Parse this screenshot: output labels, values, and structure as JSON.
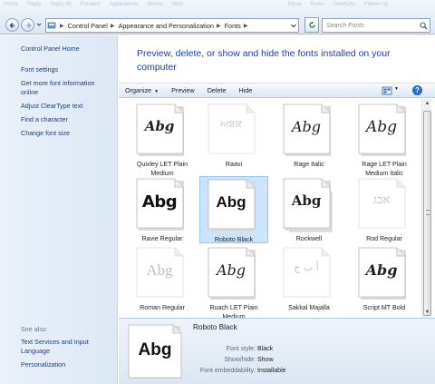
{
  "titlebar_menu_left": [
    "Home",
    "Reply",
    "Reply All",
    "Forward",
    "Applications",
    "Books",
    "Next"
  ],
  "titlebar_menu_right": [
    "Move",
    "Rules",
    "OneNote",
    "Follow Up"
  ],
  "address": {
    "crumbs": [
      "Control Panel",
      "Appearance and Personalization",
      "Fonts"
    ],
    "search_placeholder": "Search Fonts"
  },
  "sidebar": {
    "home": "Control Panel Home",
    "links": [
      "Font settings",
      "Get more font information online",
      "Adjust ClearType text",
      "Find a character",
      "Change font size"
    ],
    "see_also_label": "See also",
    "see_also": [
      "Text Services and Input Language",
      "Personalization"
    ]
  },
  "header": {
    "title": "Preview, delete, or show and hide the fonts installed on your computer"
  },
  "toolbar": {
    "organize": "Organize",
    "preview": "Preview",
    "delete": "Delete",
    "hide": "Hide"
  },
  "fonts": [
    {
      "name": "Quixley LET Plain Medium",
      "sample": "Abg",
      "hidden": false
    },
    {
      "name": "Raavi",
      "sample": "ਅਬਕ",
      "hidden": true
    },
    {
      "name": "Rage Italic",
      "sample": "Abg",
      "hidden": false
    },
    {
      "name": "Rage LET Plain Medium Italic",
      "sample": "Abg",
      "hidden": false
    },
    {
      "name": "Ravie Regular",
      "sample": "Abg",
      "hidden": false
    },
    {
      "name": "Roboto Black",
      "sample": "Abg",
      "hidden": false,
      "selected": true
    },
    {
      "name": "Rockwell",
      "sample": "Abg",
      "hidden": false
    },
    {
      "name": "Rod Regular",
      "sample": "אבג",
      "hidden": true
    },
    {
      "name": "Roman Regular",
      "sample": "Abg",
      "hidden": true
    },
    {
      "name": "Ruach LET Plain Medium",
      "sample": "Abg",
      "hidden": false
    },
    {
      "name": "Sakkal Majalla",
      "sample": "أ ب ج",
      "hidden": true
    },
    {
      "name": "Script MT Bold",
      "sample": "Abg",
      "hidden": false
    }
  ],
  "details": {
    "name": "Roboto Black",
    "sample": "Abg",
    "rows": [
      {
        "key": "Font style:",
        "value": "Black"
      },
      {
        "key": "Show/hide:",
        "value": "Show"
      },
      {
        "key": "Font embeddability:",
        "value": "Installable"
      }
    ]
  },
  "colors": {
    "link": "#1d3f7a",
    "title": "#1e3da5",
    "selection": "#cce4fb"
  }
}
